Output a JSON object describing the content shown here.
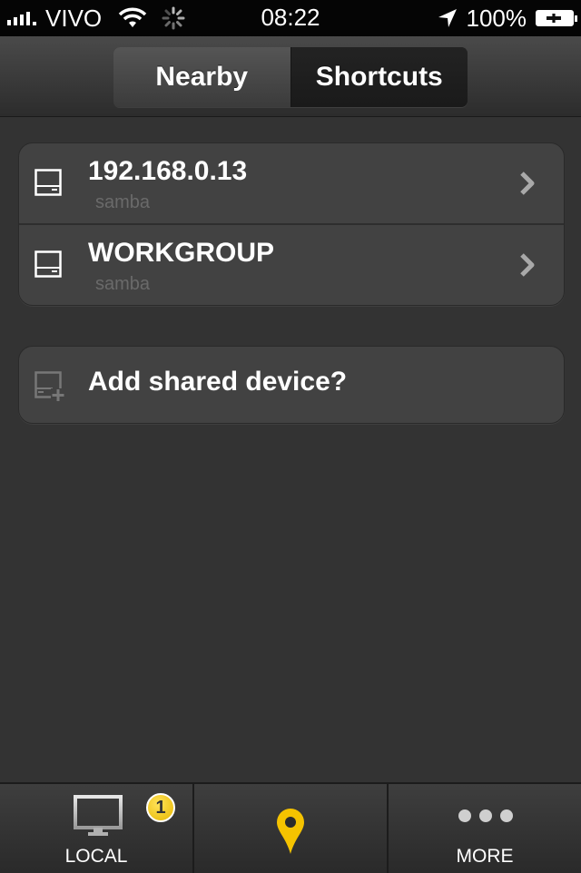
{
  "status_bar": {
    "carrier": "VIVO",
    "time": "08:22",
    "battery": "100%"
  },
  "nav": {
    "segments": [
      "Nearby",
      "Shortcuts"
    ],
    "selected": "Nearby"
  },
  "devices": [
    {
      "name": "192.168.0.13",
      "type": "samba",
      "icon": "server-icon"
    },
    {
      "name": "WORKGROUP",
      "type": "samba",
      "icon": "server-icon"
    }
  ],
  "add_device": {
    "label": "Add shared device?",
    "icon": "add-device-icon"
  },
  "tab_bar": {
    "tabs": [
      {
        "label": "LOCAL",
        "icon": "monitor-icon",
        "badge": "1"
      },
      {
        "label": "",
        "icon": "location-pin-icon"
      },
      {
        "label": "MORE",
        "icon": "more-dots-icon"
      }
    ]
  },
  "colors": {
    "background": "#333333",
    "cell": "#424242",
    "badge": "#f2c400",
    "pin": "#f5c300"
  }
}
